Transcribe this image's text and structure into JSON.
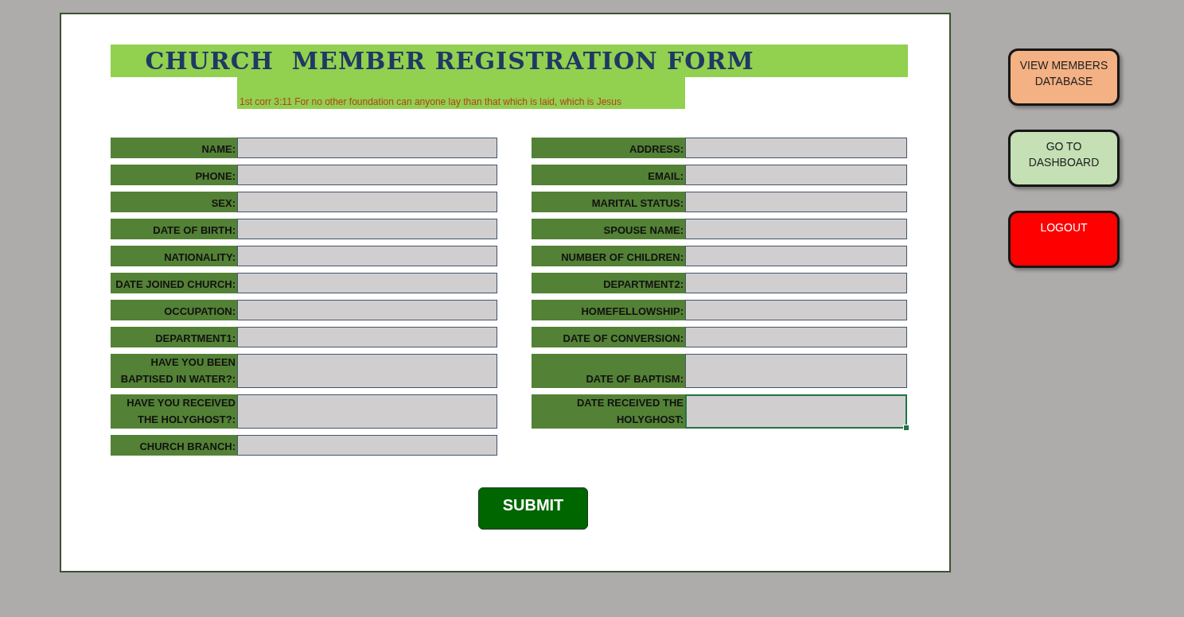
{
  "title": "CHURCH  MEMBER REGISTRATION FORM",
  "subtitle": "1st corr 3:11 For no other foundation can anyone lay than that which is laid, which is Jesus",
  "rows": [
    {
      "left": {
        "label": "NAME:",
        "selected": false
      },
      "right": {
        "label": "ADDRESS:",
        "selected": false
      }
    },
    {
      "left": {
        "label": "PHONE:",
        "selected": false
      },
      "right": {
        "label": "EMAIL:",
        "selected": false
      }
    },
    {
      "left": {
        "label": "SEX:",
        "selected": false
      },
      "right": {
        "label": "MARITAL STATUS:",
        "selected": false
      }
    },
    {
      "left": {
        "label": "DATE OF BIRTH:",
        "selected": false
      },
      "right": {
        "label": "SPOUSE NAME:",
        "selected": false
      }
    },
    {
      "left": {
        "label": "NATIONALITY:",
        "selected": false
      },
      "right": {
        "label": "NUMBER OF CHILDREN:",
        "selected": false
      }
    },
    {
      "left": {
        "label": "DATE JOINED CHURCH:",
        "selected": false
      },
      "right": {
        "label": "DEPARTMENT2:",
        "selected": false
      }
    },
    {
      "left": {
        "label": "OCCUPATION:",
        "selected": false
      },
      "right": {
        "label": "HOMEFELLOWSHIP:",
        "selected": false
      }
    },
    {
      "left": {
        "label": "DEPARTMENT1:",
        "selected": false
      },
      "right": {
        "label": "DATE OF CONVERSION:",
        "selected": false
      }
    },
    {
      "left": {
        "label": "HAVE YOU BEEN BAPTISED IN WATER?:",
        "selected": false
      },
      "right": {
        "label": "DATE OF BAPTISM:",
        "selected": false
      }
    },
    {
      "left": {
        "label": "HAVE YOU RECEIVED THE HOLYGHOST?:",
        "selected": false
      },
      "right": {
        "label": "DATE RECEIVED THE HOLYGHOST:",
        "selected": true
      }
    },
    {
      "left": {
        "label": "CHURCH BRANCH:",
        "selected": false
      }
    }
  ],
  "submit": "SUBMIT",
  "side_buttons": [
    {
      "label": "VIEW MEMBERS DATABASE",
      "color": "#f4b183"
    },
    {
      "label": "GO TO DASHBOARD",
      "color": "#c5e0b4"
    },
    {
      "label": "LOGOUT",
      "color": "#ff0000"
    }
  ]
}
